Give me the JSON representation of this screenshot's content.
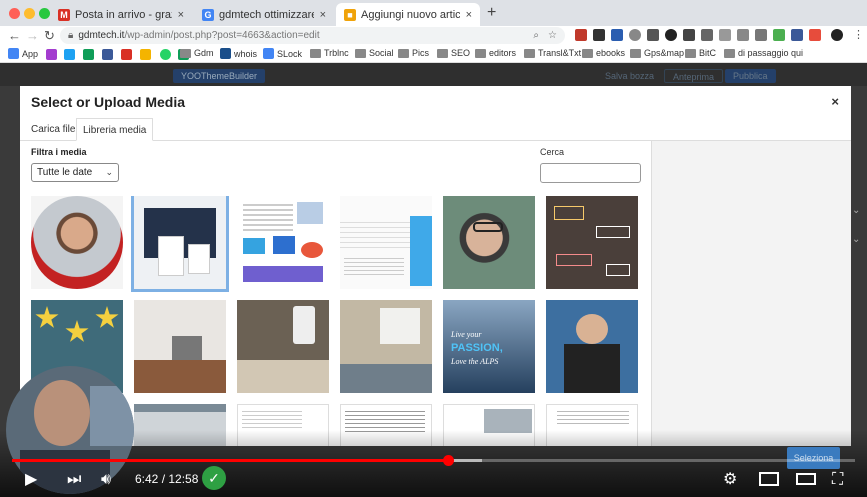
{
  "browser": {
    "tabs": [
      {
        "label": "Posta in arrivo - graziano.demat",
        "fav_color": "#d93025",
        "fav_glyph": "M"
      },
      {
        "label": "gdmtech ottimizzare scrivere ur",
        "fav_color": "#4285f4",
        "fav_glyph": "G"
      },
      {
        "label": "Aggiungi nuovo articolo ‹ Gd",
        "fav_color": "#f0a30a",
        "fav_glyph": "■"
      }
    ],
    "url_domain": "gdmtech.it",
    "url_path": "/wp-admin/post.php?post=4663&action=edit",
    "bookmarks": [
      {
        "label": "App",
        "type": "apps"
      },
      {
        "label": "Gdm",
        "type": "folder"
      },
      {
        "label": "whois",
        "type": "site"
      },
      {
        "label": "SLock",
        "type": "site"
      },
      {
        "label": "Trblnc",
        "type": "folder"
      },
      {
        "label": "Social",
        "type": "folder"
      },
      {
        "label": "Pics",
        "type": "folder"
      },
      {
        "label": "SEO",
        "type": "folder"
      },
      {
        "label": "editors",
        "type": "folder"
      },
      {
        "label": "Transl&Txt",
        "type": "folder"
      },
      {
        "label": "ebooks",
        "type": "folder"
      },
      {
        "label": "Gps&map",
        "type": "folder"
      },
      {
        "label": "BitC",
        "type": "folder"
      },
      {
        "label": "di passaggio qui",
        "type": "folder"
      }
    ]
  },
  "wp": {
    "yoast_label": "YOOThemeBuilder",
    "save_draft": "Salva bozza",
    "preview": "Anteprima",
    "publish": "Pubblica"
  },
  "modal": {
    "title": "Select or Upload Media",
    "close": "×",
    "tabs": [
      "Carica file",
      "Libreria media"
    ],
    "active_tab": 1,
    "filter_label": "Filtra i media",
    "date_filter_value": "Tutte le date",
    "search_label": "Cerca",
    "search_value": "",
    "select_button": "Seleziona",
    "selected_index": 1,
    "thumbnails": [
      {
        "kind": "portrait-circle"
      },
      {
        "kind": "website-mockup"
      },
      {
        "kind": "infographic"
      },
      {
        "kind": "article-screenshot"
      },
      {
        "kind": "man-glasses"
      },
      {
        "kind": "chalkboard-diagram"
      },
      {
        "kind": "stars-people"
      },
      {
        "kind": "desk-laptop"
      },
      {
        "kind": "phone-hand"
      },
      {
        "kind": "office-meeting"
      },
      {
        "kind": "alps-poster"
      },
      {
        "kind": "man-reading"
      },
      {
        "kind": "screenshot-gray"
      },
      {
        "kind": "screenshot-page"
      },
      {
        "kind": "screenshot-text"
      },
      {
        "kind": "screenshot-photo"
      },
      {
        "kind": "screenshot-doc"
      }
    ],
    "alps_text_1": "Live your",
    "alps_text_2": "PASSION,",
    "alps_text_3": "Love the ALPS"
  },
  "player": {
    "current_time": "6:42",
    "total_time": "12:58",
    "time_separator": " / ",
    "played_fraction": 0.517,
    "loaded_fraction": 0.557
  }
}
